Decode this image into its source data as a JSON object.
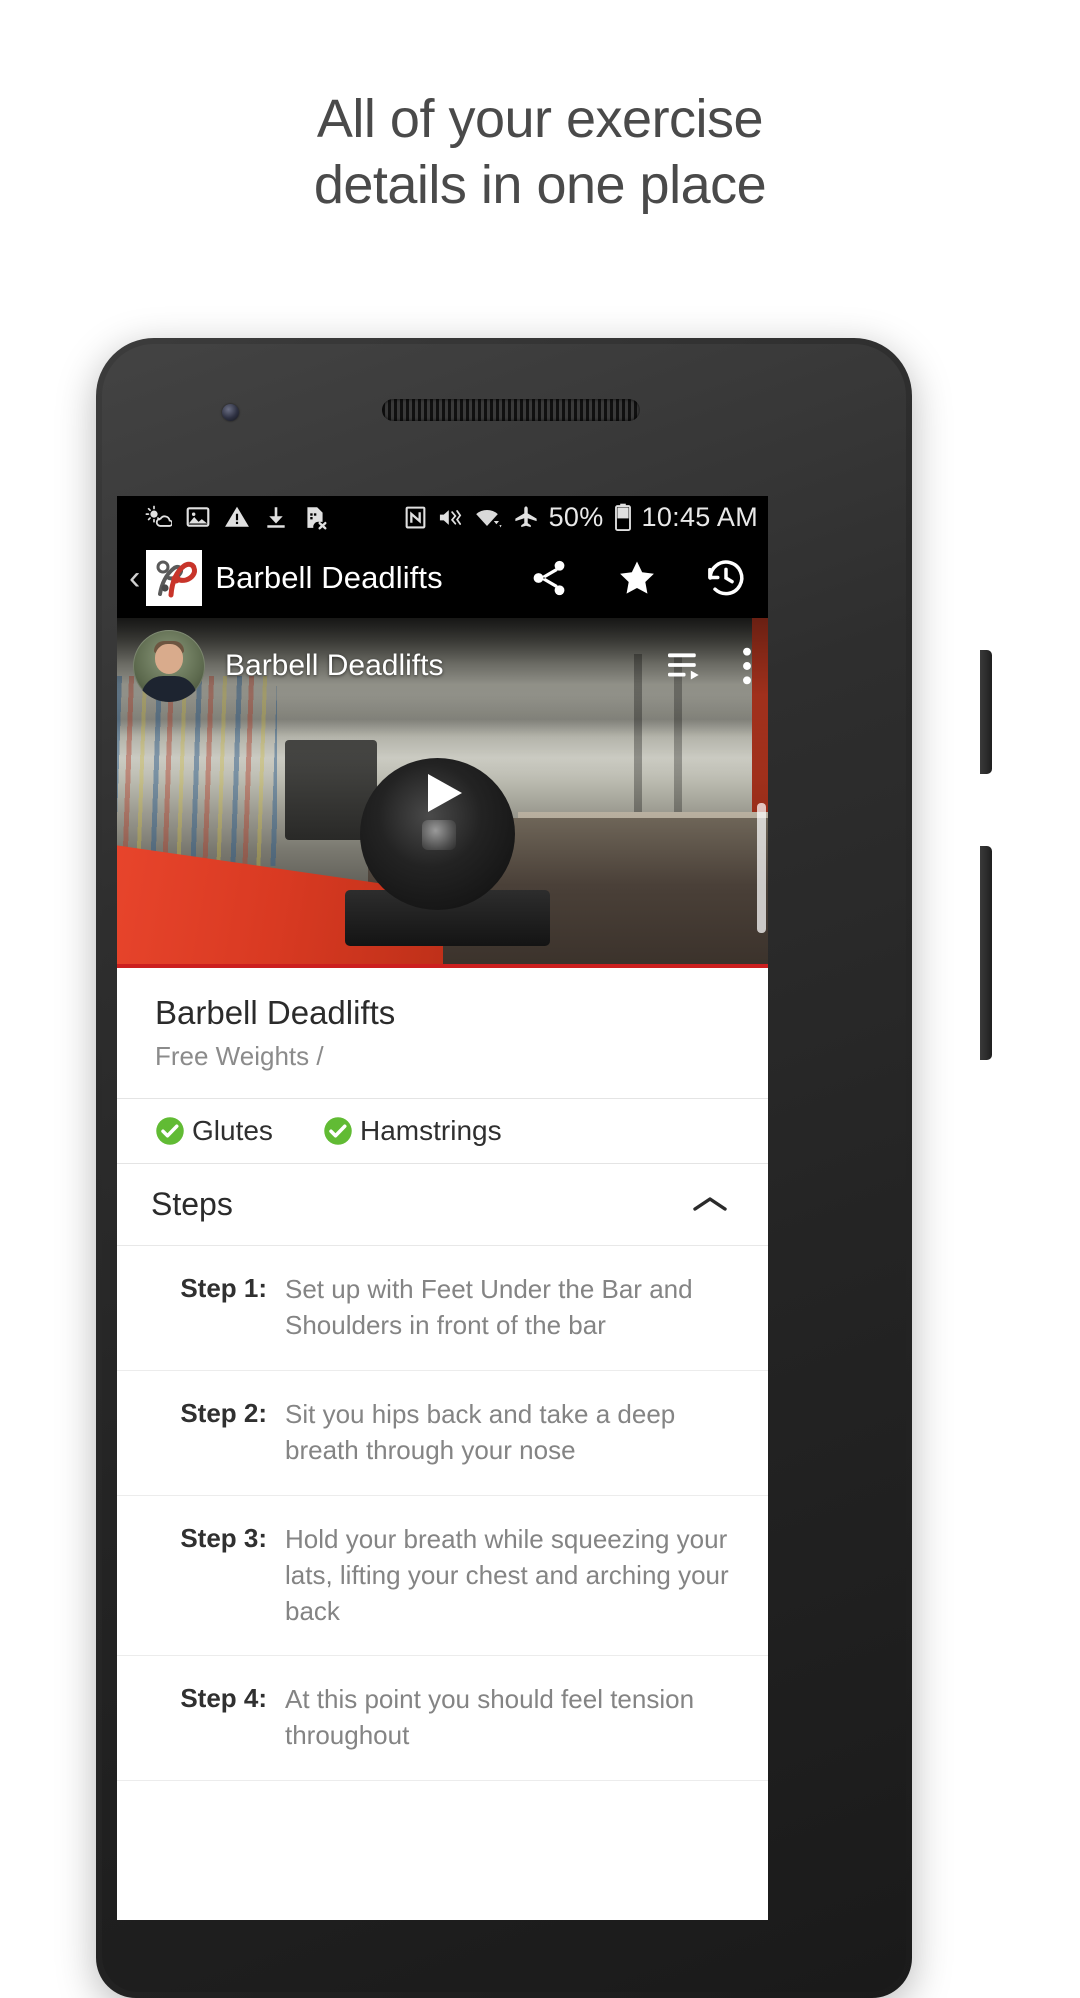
{
  "promo": {
    "headline_line1": "All of your exercise",
    "headline_line2": "details in one place"
  },
  "colors": {
    "accent_green": "#61bb34",
    "brand_red": "#c8342a",
    "appbar_bg": "#000000",
    "progress_red": "#cc1f1f"
  },
  "status_bar": {
    "left_icons": [
      "weather-partly-sunny-icon",
      "image-icon",
      "warning-triangle-icon",
      "download-icon",
      "sim-card-removed-icon"
    ],
    "right_icons": [
      "nfc-icon",
      "mute-vibrate-icon",
      "wifi-icon",
      "airplane-mode-icon"
    ],
    "battery_percent": "50%",
    "battery_icon": "battery-icon",
    "clock": "10:45 AM"
  },
  "app_bar": {
    "back_icon": "back-chevron-icon",
    "logo_icon": "app-logo-icon",
    "title": "Barbell Deadlifts",
    "actions": [
      {
        "name": "share-icon",
        "label": "Share"
      },
      {
        "name": "star-icon",
        "label": "Favorite"
      },
      {
        "name": "history-icon",
        "label": "History"
      }
    ]
  },
  "video": {
    "title": "Barbell Deadlifts",
    "avatar_icon": "channel-avatar",
    "play_icon": "play-icon",
    "overlay_actions": [
      {
        "name": "playlist-queue-icon",
        "label": "Watch later / queue"
      },
      {
        "name": "more-vertical-icon",
        "label": "More options"
      }
    ]
  },
  "exercise": {
    "name": "Barbell Deadlifts",
    "category": "Free Weights /",
    "muscles": [
      {
        "label": "Glutes",
        "icon": "check-circle-icon"
      },
      {
        "label": "Hamstrings",
        "icon": "check-circle-icon"
      }
    ]
  },
  "steps_section": {
    "title": "Steps",
    "collapse_icon": "chevron-up-icon",
    "steps": [
      {
        "label": "Step 1:",
        "text": "Set up with Feet Under the Bar and Shoulders in front of the bar"
      },
      {
        "label": "Step 2:",
        "text": "Sit you hips back and take a deep breath through your nose"
      },
      {
        "label": "Step 3:",
        "text": "Hold your breath while squeezing your lats, lifting your chest and arching your back"
      },
      {
        "label": "Step 4:",
        "text": "At this point you should feel tension throughout"
      }
    ]
  }
}
